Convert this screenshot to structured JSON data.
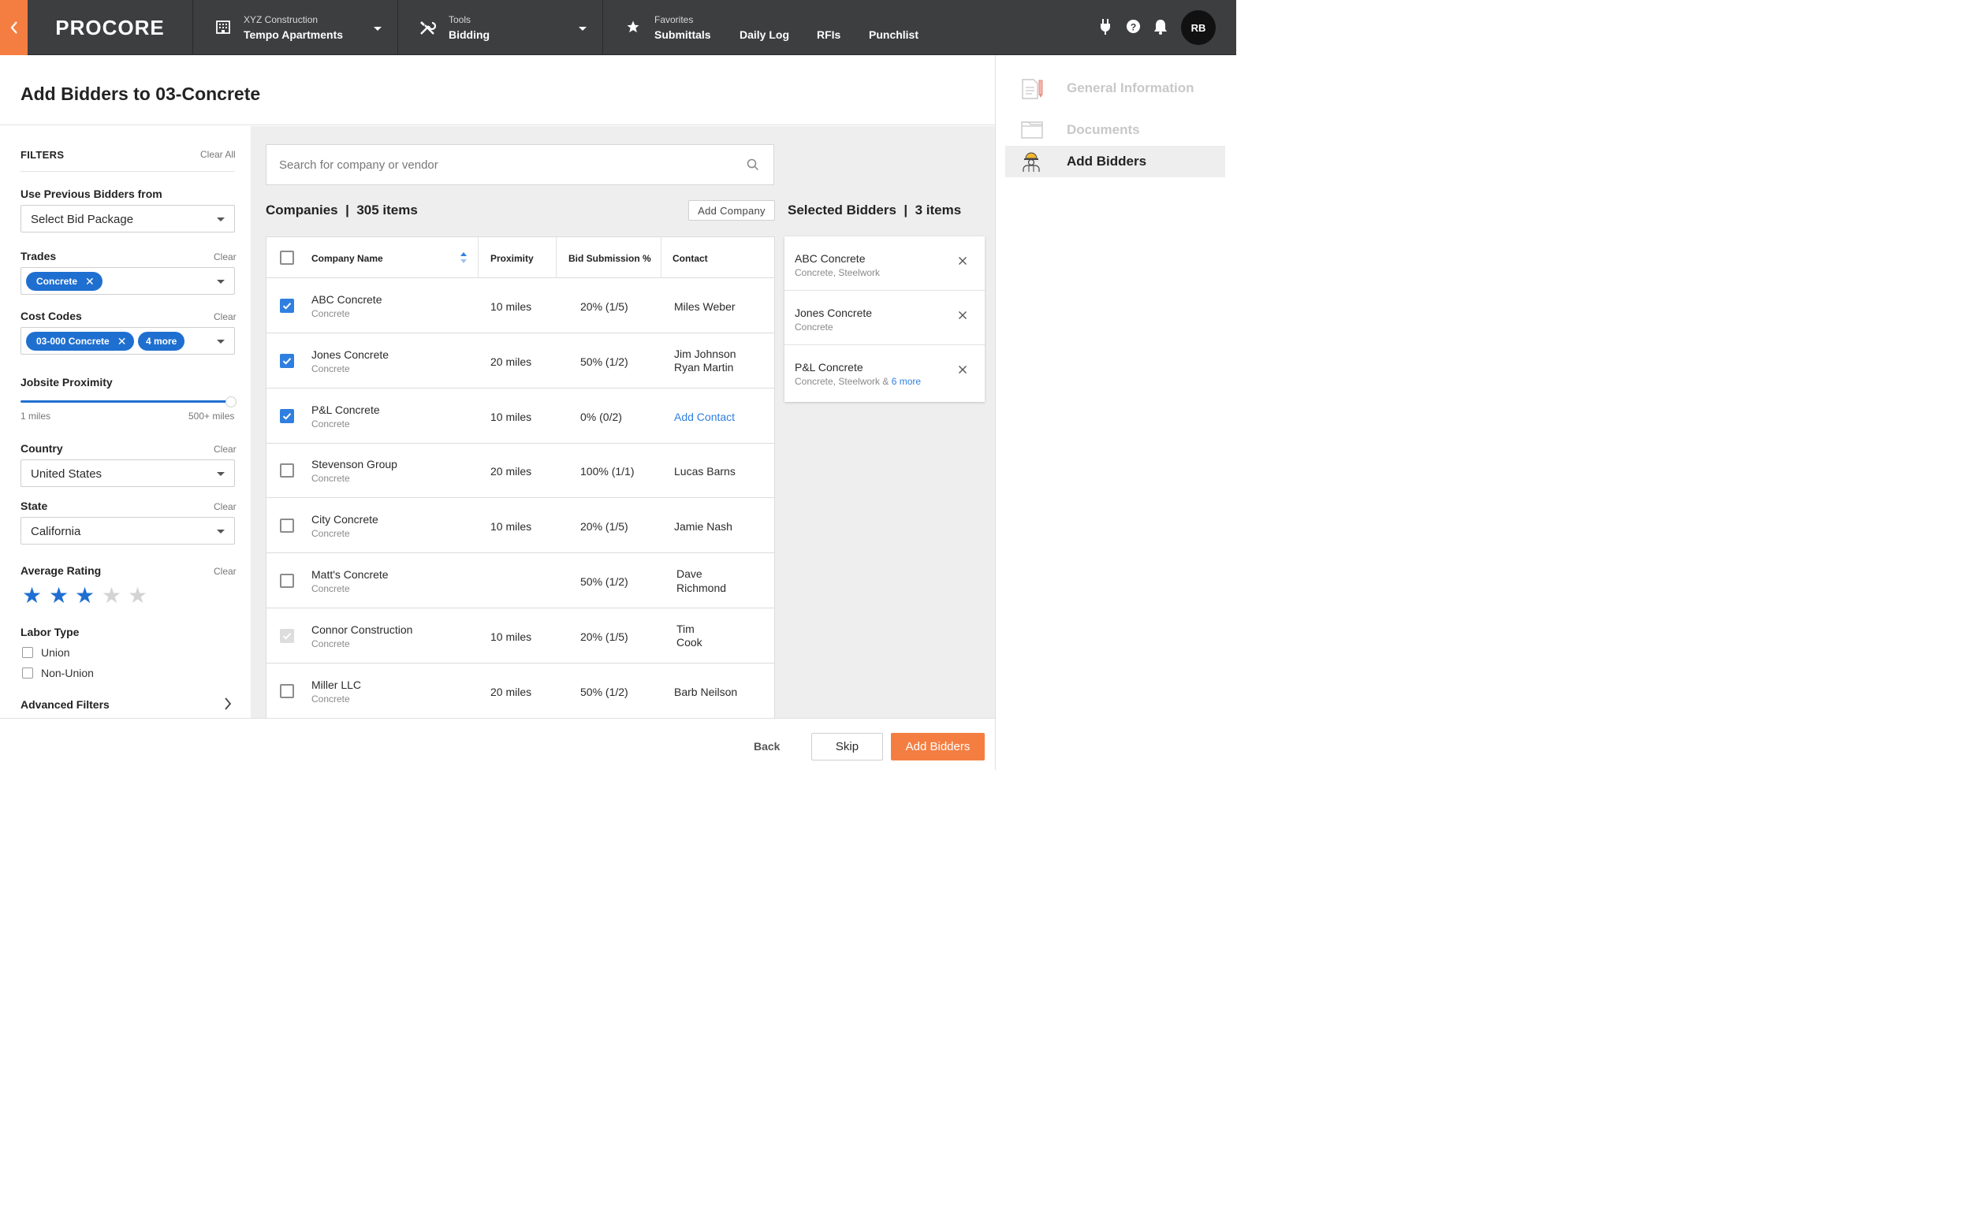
{
  "nav": {
    "logo": "PROCORE",
    "project_company": "XYZ Construction",
    "project_name": "Tempo Apartments",
    "tools_label": "Tools",
    "tools_current": "Bidding",
    "favorites_label": "Favorites",
    "favorites": [
      "Submittals",
      "Daily Log",
      "RFIs",
      "Punchlist"
    ],
    "user_initials": "RB"
  },
  "page": {
    "title": "Add Bidders to 03-Concrete"
  },
  "filters": {
    "heading": "FILTERS",
    "clear_all": "Clear All",
    "clear": "Clear",
    "previous_bidders_label": "Use Previous Bidders from",
    "previous_bidders_value": "Select Bid Package",
    "trades_label": "Trades",
    "trades_selected": [
      "Concrete"
    ],
    "cost_codes_label": "Cost Codes",
    "cost_codes_selected": [
      "03-000 Concrete"
    ],
    "cost_codes_more": "4 more",
    "proximity_label": "Jobsite Proximity",
    "proximity_min": "1 miles",
    "proximity_max": "500+ miles",
    "proximity_fraction": 1.0,
    "country_label": "Country",
    "country_value": "United States",
    "state_label": "State",
    "state_value": "California",
    "rating_label": "Average Rating",
    "rating_value": 3,
    "rating_max": 5,
    "labor_label": "Labor Type",
    "labor_options": [
      "Union",
      "Non-Union"
    ],
    "advanced_label": "Advanced Filters"
  },
  "search": {
    "placeholder": "Search for company or vendor"
  },
  "companies": {
    "title": "Companies",
    "count_text": "305 items",
    "add_company_label": "Add Company",
    "columns": [
      "Company Name",
      "Proximity",
      "Bid Submission %",
      "Contact"
    ],
    "rows": [
      {
        "name": "ABC Concrete",
        "trade": "Concrete",
        "proximity": "10 miles",
        "bid": "20% (1/5)",
        "contact": [
          "Miles Weber"
        ],
        "checked": true,
        "disabled": false,
        "contact_link": false
      },
      {
        "name": "Jones Concrete",
        "trade": "Concrete",
        "proximity": "20 miles",
        "bid": "50% (1/2)",
        "contact": [
          "Jim Johnson",
          "Ryan Martin"
        ],
        "checked": true,
        "disabled": false,
        "contact_link": false
      },
      {
        "name": "P&L Concrete",
        "trade": "Concrete",
        "proximity": "10 miles",
        "bid": "0% (0/2)",
        "contact": [
          "Add Contact"
        ],
        "checked": true,
        "disabled": false,
        "contact_link": true
      },
      {
        "name": "Stevenson Group",
        "trade": "Concrete",
        "proximity": "20 miles",
        "bid": "100% (1/1)",
        "contact": [
          "Lucas Barns"
        ],
        "checked": false,
        "disabled": false,
        "contact_link": false
      },
      {
        "name": "City Concrete",
        "trade": "Concrete",
        "proximity": "10 miles",
        "bid": "20% (1/5)",
        "contact": [
          "Jamie Nash"
        ],
        "checked": false,
        "disabled": false,
        "contact_link": false
      },
      {
        "name": "Matt's Concrete",
        "trade": "Concrete",
        "proximity": "",
        "bid": "50% (1/2)",
        "contact": [
          "Dave",
          "Richmond"
        ],
        "checked": false,
        "disabled": false,
        "contact_link": false
      },
      {
        "name": "Connor Construction",
        "trade": "Concrete",
        "proximity": "10 miles",
        "bid": "20% (1/5)",
        "contact": [
          "Tim",
          "Cook"
        ],
        "checked": true,
        "disabled": true,
        "contact_link": false
      },
      {
        "name": "Miller LLC",
        "trade": "Concrete",
        "proximity": "20 miles",
        "bid": "50% (1/2)",
        "contact": [
          "Barb Neilson"
        ],
        "checked": false,
        "disabled": false,
        "contact_link": false
      }
    ]
  },
  "selected": {
    "title": "Selected Bidders",
    "count_text": "3 items",
    "items": [
      {
        "name": "ABC Concrete",
        "trades": "Concrete, Steelwork",
        "more": ""
      },
      {
        "name": "Jones Concrete",
        "trades": "Concrete",
        "more": ""
      },
      {
        "name": "P&L Concrete",
        "trades": "Concrete, Steelwork & ",
        "more": "6 more"
      }
    ]
  },
  "footer": {
    "back": "Back",
    "skip": "Skip",
    "add_bidders": "Add Bidders"
  },
  "steps": [
    {
      "label": "General Information",
      "icon": "document-pencil-icon",
      "active": false
    },
    {
      "label": "Documents",
      "icon": "folder-icon",
      "active": false
    },
    {
      "label": "Add Bidders",
      "icon": "worker-icon",
      "active": true
    }
  ],
  "colors": {
    "brand_orange": "#f47e42",
    "nav_bg": "#3d3e40",
    "primary_blue": "#1f6fd0",
    "star_empty": "#d4d4d4"
  }
}
